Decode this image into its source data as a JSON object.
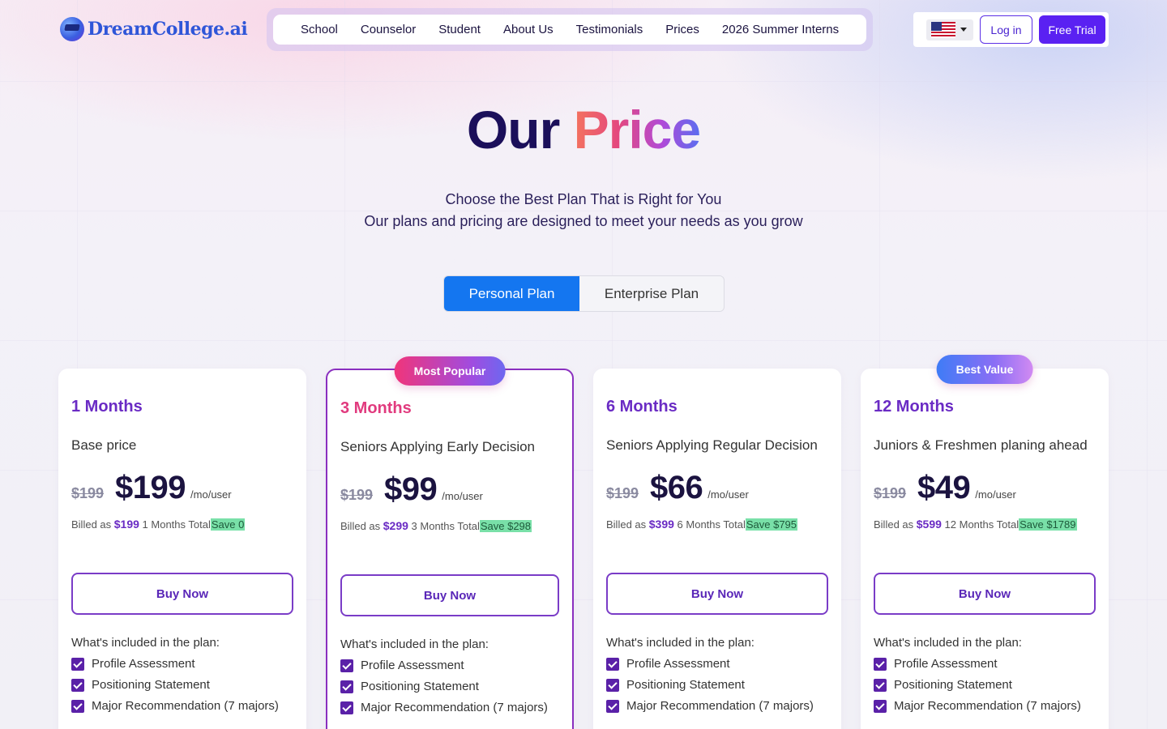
{
  "header": {
    "logo_text": "DreamCollege.ai",
    "nav": [
      "School",
      "Counselor",
      "Student",
      "About Us",
      "Testimonials",
      "Prices",
      "2026 Summer Interns"
    ],
    "language_flag": "us-flag-icon",
    "login_label": "Log in",
    "trial_label": "Free Trial"
  },
  "hero": {
    "title_part1": "Our",
    "title_part2": "Price",
    "subtitle_line1": "Choose the Best Plan That is Right for You",
    "subtitle_line2": "Our plans and pricing are designed to meet your needs as you grow"
  },
  "toggle": {
    "personal": "Personal Plan",
    "enterprise": "Enterprise Plan",
    "selected": "Personal Plan"
  },
  "colors": {
    "accent": "#5a21f2",
    "toggle_active": "#1476f0",
    "plan_purple": "#6a2bc4",
    "popular_pink": "#e13a7e",
    "save_green": "#79e0a8"
  },
  "plans": [
    {
      "name": "1 Months",
      "desc": "Base price",
      "old_price": "$199",
      "price": "$199",
      "per": "/mo/user",
      "billed_prefix": "Billed as",
      "billed_amount": "$199",
      "billed_suffix": "1 Months Total",
      "save": "Save 0",
      "buy": "Buy Now",
      "included_title": "What's included in the plan:",
      "features": [
        "Profile Assessment",
        "Positioning Statement",
        "Major Recommendation (7 majors)"
      ]
    },
    {
      "name": "3 Months",
      "badge": "Most Popular",
      "desc": "Seniors Applying Early Decision",
      "old_price": "$199",
      "price": "$99",
      "per": "/mo/user",
      "billed_prefix": "Billed as",
      "billed_amount": "$299",
      "billed_suffix": "3 Months Total",
      "save": "Save $298",
      "buy": "Buy Now",
      "included_title": "What's included in the plan:",
      "features": [
        "Profile Assessment",
        "Positioning Statement",
        "Major Recommendation (7 majors)"
      ]
    },
    {
      "name": "6 Months",
      "desc": "Seniors Applying Regular Decision",
      "old_price": "$199",
      "price": "$66",
      "per": "/mo/user",
      "billed_prefix": "Billed as",
      "billed_amount": "$399",
      "billed_suffix": "6 Months Total",
      "save": "Save $795",
      "buy": "Buy Now",
      "included_title": "What's included in the plan:",
      "features": [
        "Profile Assessment",
        "Positioning Statement",
        "Major Recommendation (7 majors)"
      ]
    },
    {
      "name": "12 Months",
      "badge": "Best Value",
      "desc": "Juniors & Freshmen planing ahead",
      "old_price": "$199",
      "price": "$49",
      "per": "/mo/user",
      "billed_prefix": "Billed as",
      "billed_amount": "$599",
      "billed_suffix": "12 Months Total",
      "save": "Save $1789",
      "buy": "Buy Now",
      "included_title": "What's included in the plan:",
      "features": [
        "Profile Assessment",
        "Positioning Statement",
        "Major Recommendation (7 majors)"
      ]
    }
  ]
}
